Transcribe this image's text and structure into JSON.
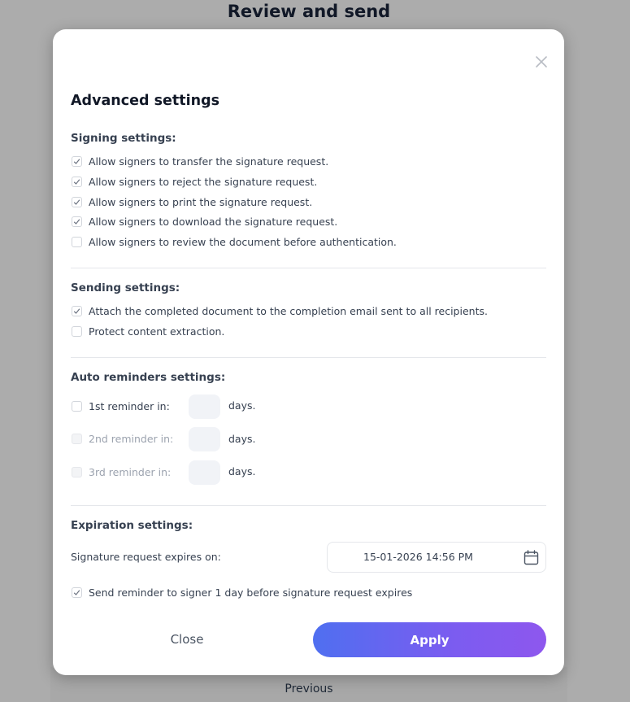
{
  "page": {
    "title": "Review and send",
    "previous_label": "Previous"
  },
  "modal": {
    "title": "Advanced settings",
    "signing": {
      "title": "Signing settings:",
      "options": [
        {
          "label": "Allow signers to transfer the signature request.",
          "checked": true
        },
        {
          "label": "Allow signers to reject the signature request.",
          "checked": true
        },
        {
          "label": "Allow signers to print the signature request.",
          "checked": true
        },
        {
          "label": "Allow signers to download the signature request.",
          "checked": true
        },
        {
          "label": "Allow signers to review the document before authentication.",
          "checked": false
        }
      ]
    },
    "sending": {
      "title": "Sending settings:",
      "options": [
        {
          "label": "Attach the completed document to the completion email sent to all recipients.",
          "checked": true
        },
        {
          "label": "Protect content extraction.",
          "checked": false
        }
      ]
    },
    "reminders": {
      "title": "Auto reminders settings:",
      "days_label": "days.",
      "items": [
        {
          "label": "1st reminder in:",
          "checked": false,
          "enabled": true,
          "value": ""
        },
        {
          "label": "2nd reminder in:",
          "checked": false,
          "enabled": false,
          "value": ""
        },
        {
          "label": "3rd reminder in:",
          "checked": false,
          "enabled": false,
          "value": ""
        }
      ]
    },
    "expiration": {
      "title": "Expiration settings:",
      "expires_label": "Signature request expires on:",
      "date_value": "15-01-2026 14:56 PM",
      "reminder": {
        "label": "Send reminder to signer 1 day before signature request expires",
        "checked": true
      }
    },
    "buttons": {
      "close": "Close",
      "apply": "Apply"
    }
  },
  "colors": {
    "accent_start": "#4f6ff0",
    "accent_end": "#8e57ee",
    "checkmark": "#6b7280"
  }
}
